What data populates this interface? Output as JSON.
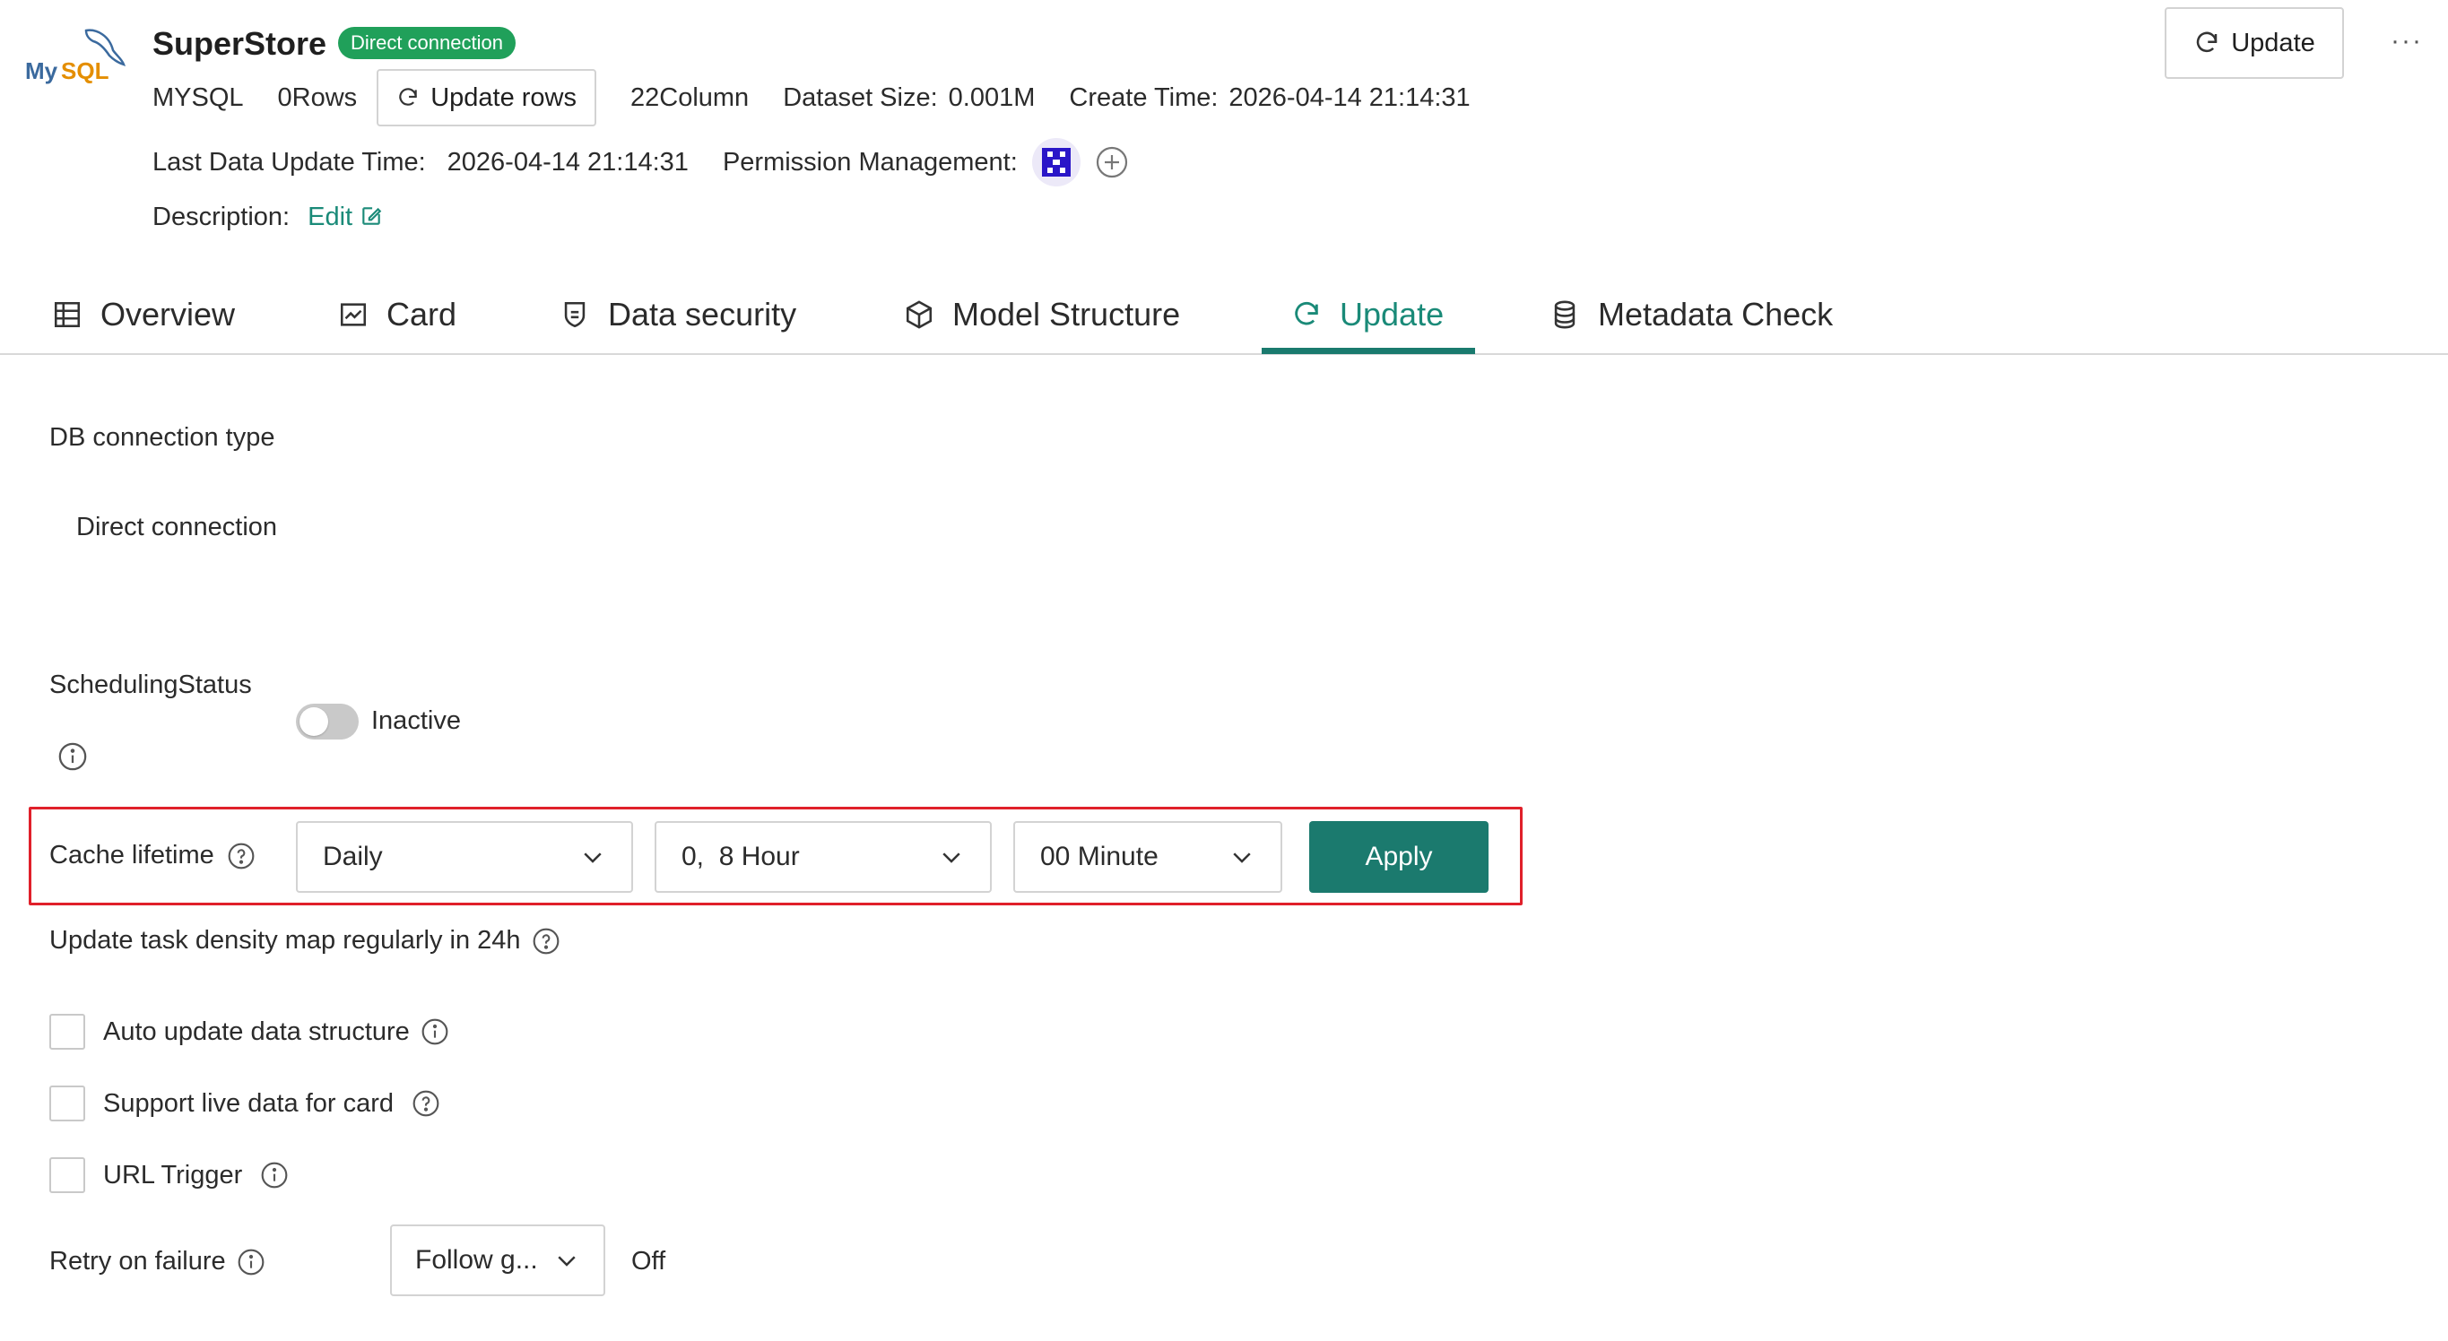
{
  "header": {
    "logo_text": "MySQL",
    "title": "SuperStore",
    "badge": "Direct connection",
    "db_type": "MYSQL",
    "rows": "0Rows",
    "update_rows_label": "Update rows",
    "columns": "22Column",
    "dataset_size_label": "Dataset Size:",
    "dataset_size_value": "0.001M",
    "create_time_label": "Create Time:",
    "create_time_value": "2026-04-14 21:14:31",
    "last_update_label": "Last Data Update Time:",
    "last_update_value": "2026-04-14 21:14:31",
    "permission_label": "Permission Management:",
    "description_label": "Description:",
    "edit_label": "Edit",
    "update_button": "Update",
    "more": "···"
  },
  "tabs": [
    {
      "label": "Overview",
      "icon": "table-icon",
      "active": false
    },
    {
      "label": "Card",
      "icon": "chart-card-icon",
      "active": false
    },
    {
      "label": "Data security",
      "icon": "shield-icon",
      "active": false
    },
    {
      "label": "Model Structure",
      "icon": "cube-icon",
      "active": false
    },
    {
      "label": "Update",
      "icon": "refresh-icon",
      "active": true
    },
    {
      "label": "Metadata Check",
      "icon": "database-icon",
      "active": false
    }
  ],
  "content": {
    "db_connection_type_label": "DB connection type",
    "db_connection_type_value": "Direct connection",
    "scheduling_status_label": "SchedulingStatus",
    "scheduling_status_value": "Inactive",
    "cache_lifetime_label": "Cache lifetime",
    "cache_frequency": "Daily",
    "cache_hour": "0,  8 Hour",
    "cache_minute": "00 Minute",
    "apply_label": "Apply",
    "density_map_label": "Update task density map regularly in 24h",
    "auto_update_label": "Auto update data structure",
    "live_data_label": "Support live data for card",
    "url_trigger_label": "URL Trigger",
    "retry_label": "Retry on failure",
    "retry_value": "Follow g...",
    "retry_status": "Off"
  },
  "colors": {
    "accent": "#1a8a78",
    "primary_button": "#1b7a6e",
    "badge": "#20a05a",
    "highlight_box": "#e0202a"
  }
}
